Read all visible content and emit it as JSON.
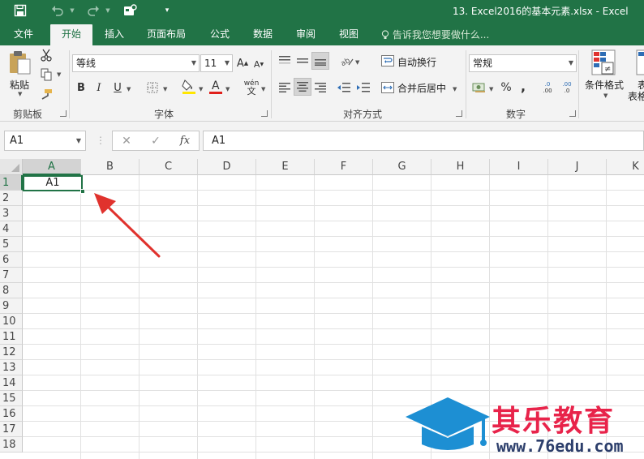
{
  "window": {
    "title": "13. Excel2016的基本元素.xlsx - Excel"
  },
  "tabs": [
    "文件",
    "开始",
    "插入",
    "页面布局",
    "公式",
    "数据",
    "审阅",
    "视图"
  ],
  "active_tab": "开始",
  "tell_me": "告诉我您想要做什么...",
  "ribbon": {
    "clipboard": {
      "paste_label": "粘贴",
      "group_label": "剪贴板"
    },
    "font": {
      "name": "等线",
      "size": "11",
      "group_label": "字体",
      "wen_label": "wén"
    },
    "alignment": {
      "wrap_label": "自动换行",
      "merge_label": "合并后居中",
      "group_label": "对齐方式"
    },
    "number": {
      "format": "常规",
      "percent": "%",
      "comma": ",",
      "group_label": "数字",
      "inc_decimal": ".00",
      "dec_decimal": ".0"
    },
    "styles": {
      "conditional_label": "条件格式",
      "table_label_partial": "表",
      "table_label_partial2": "表格"
    }
  },
  "formula_bar": {
    "name_box": "A1",
    "formula": "A1",
    "fx": "fx"
  },
  "sheet": {
    "columns": [
      "A",
      "B",
      "C",
      "D",
      "E",
      "F",
      "G",
      "H",
      "I",
      "J",
      "K"
    ],
    "rows": [
      "1",
      "2",
      "3",
      "4",
      "5",
      "6",
      "7",
      "8",
      "9",
      "10",
      "11",
      "12",
      "13",
      "14",
      "15",
      "16",
      "17",
      "18"
    ],
    "selected_cell": "A1",
    "selected_cell_value": "A1"
  },
  "watermark": {
    "text": "其乐教育",
    "url": "www.76edu.com"
  },
  "colors": {
    "excel_green": "#217346",
    "arrow_red": "#e0322d",
    "watermark_red": "#e8234a",
    "watermark_blue": "#1d8fd3"
  }
}
